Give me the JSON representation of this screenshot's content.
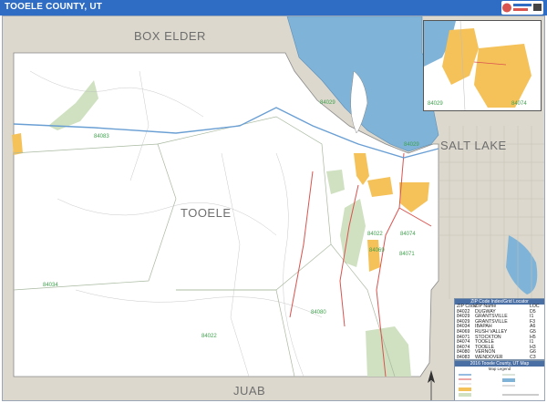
{
  "header": {
    "title": "TOOELE COUNTY, UT"
  },
  "map": {
    "county_labels": {
      "north": "BOX ELDER",
      "center": "TOOELE",
      "south": "JUAB",
      "east": "SALT LAKE"
    },
    "zip_labels": [
      "84029",
      "84083",
      "84029",
      "84074",
      "84022",
      "84069",
      "84071",
      "84080",
      "84034",
      "84022"
    ],
    "inset_zip_labels": [
      "84029",
      "84074"
    ],
    "colors": {
      "water": "#7fb3d8",
      "land": "#ffffff",
      "urban": "#f5c25a",
      "park": "#cfe1c0",
      "neighbor": "#dcd8cd",
      "roads": "#d9534f",
      "interstate": "#6a9fd4"
    }
  },
  "zip_index": {
    "title": "ZIP Code Index/Grid Locator",
    "columns": [
      "ZIP Code",
      "ZIP Name",
      "LOC"
    ],
    "rows": [
      [
        "84022",
        "DUGWAY",
        "D5"
      ],
      [
        "84029",
        "GRANTSVILLE",
        "I1"
      ],
      [
        "84029",
        "GRANTSVILLE",
        "F3"
      ],
      [
        "84034",
        "IBAPAH",
        "A6"
      ],
      [
        "84069",
        "RUSH VALLEY",
        "G5"
      ],
      [
        "84071",
        "STOCKTON",
        "H5"
      ],
      [
        "84074",
        "TOOELE",
        "I1"
      ],
      [
        "84074",
        "TOOELE",
        "H3"
      ],
      [
        "84080",
        "VERNON",
        "G6"
      ],
      [
        "84083",
        "WENDOVER",
        "C3"
      ]
    ]
  },
  "legend": {
    "title": "2016 Tooele County, UT Map",
    "subtitle": "Map Legend"
  }
}
